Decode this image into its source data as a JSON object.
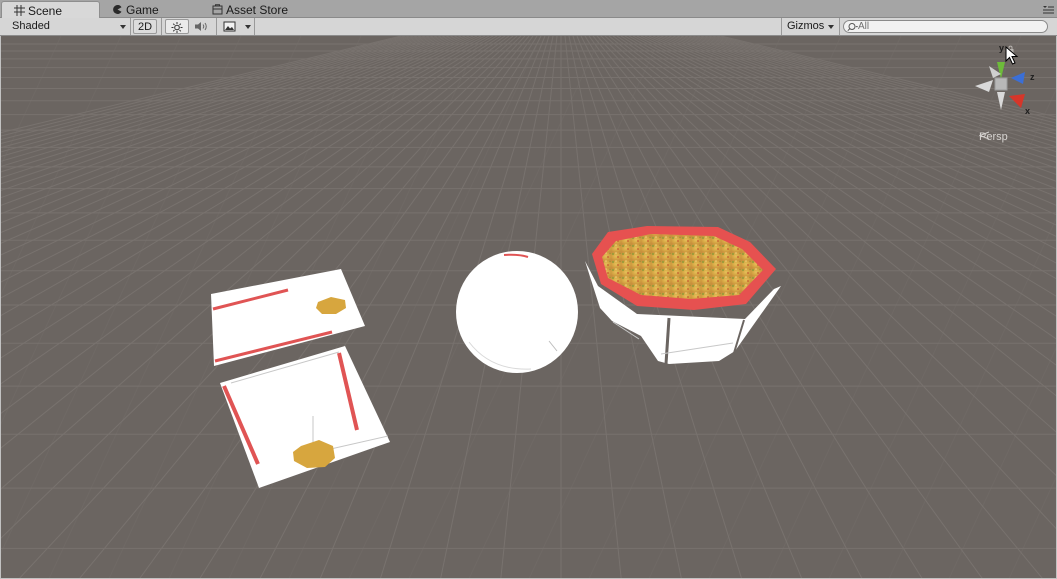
{
  "tabs": [
    {
      "label": "Scene",
      "icon": "grid-icon",
      "active": true
    },
    {
      "label": "Game",
      "icon": "pacman-icon",
      "active": false
    },
    {
      "label": "Asset Store",
      "icon": "store-icon",
      "active": false
    }
  ],
  "toolbar": {
    "shading_mode": "Shaded",
    "mode_2d_label": "2D",
    "gizmos_label": "Gizmos",
    "search_placeholder": "All"
  },
  "gizmo": {
    "projection_label": "Persp",
    "axes": {
      "x": "x",
      "y": "y",
      "z": "z"
    },
    "colors": {
      "x": "#d6362a",
      "y": "#6dbb3a",
      "z": "#3b6fd6"
    }
  },
  "scene": {
    "background": "#6b6561",
    "objects": [
      "open-box-lid",
      "open-box-bottom",
      "white-sphere",
      "octagonal-pizza-box"
    ]
  }
}
